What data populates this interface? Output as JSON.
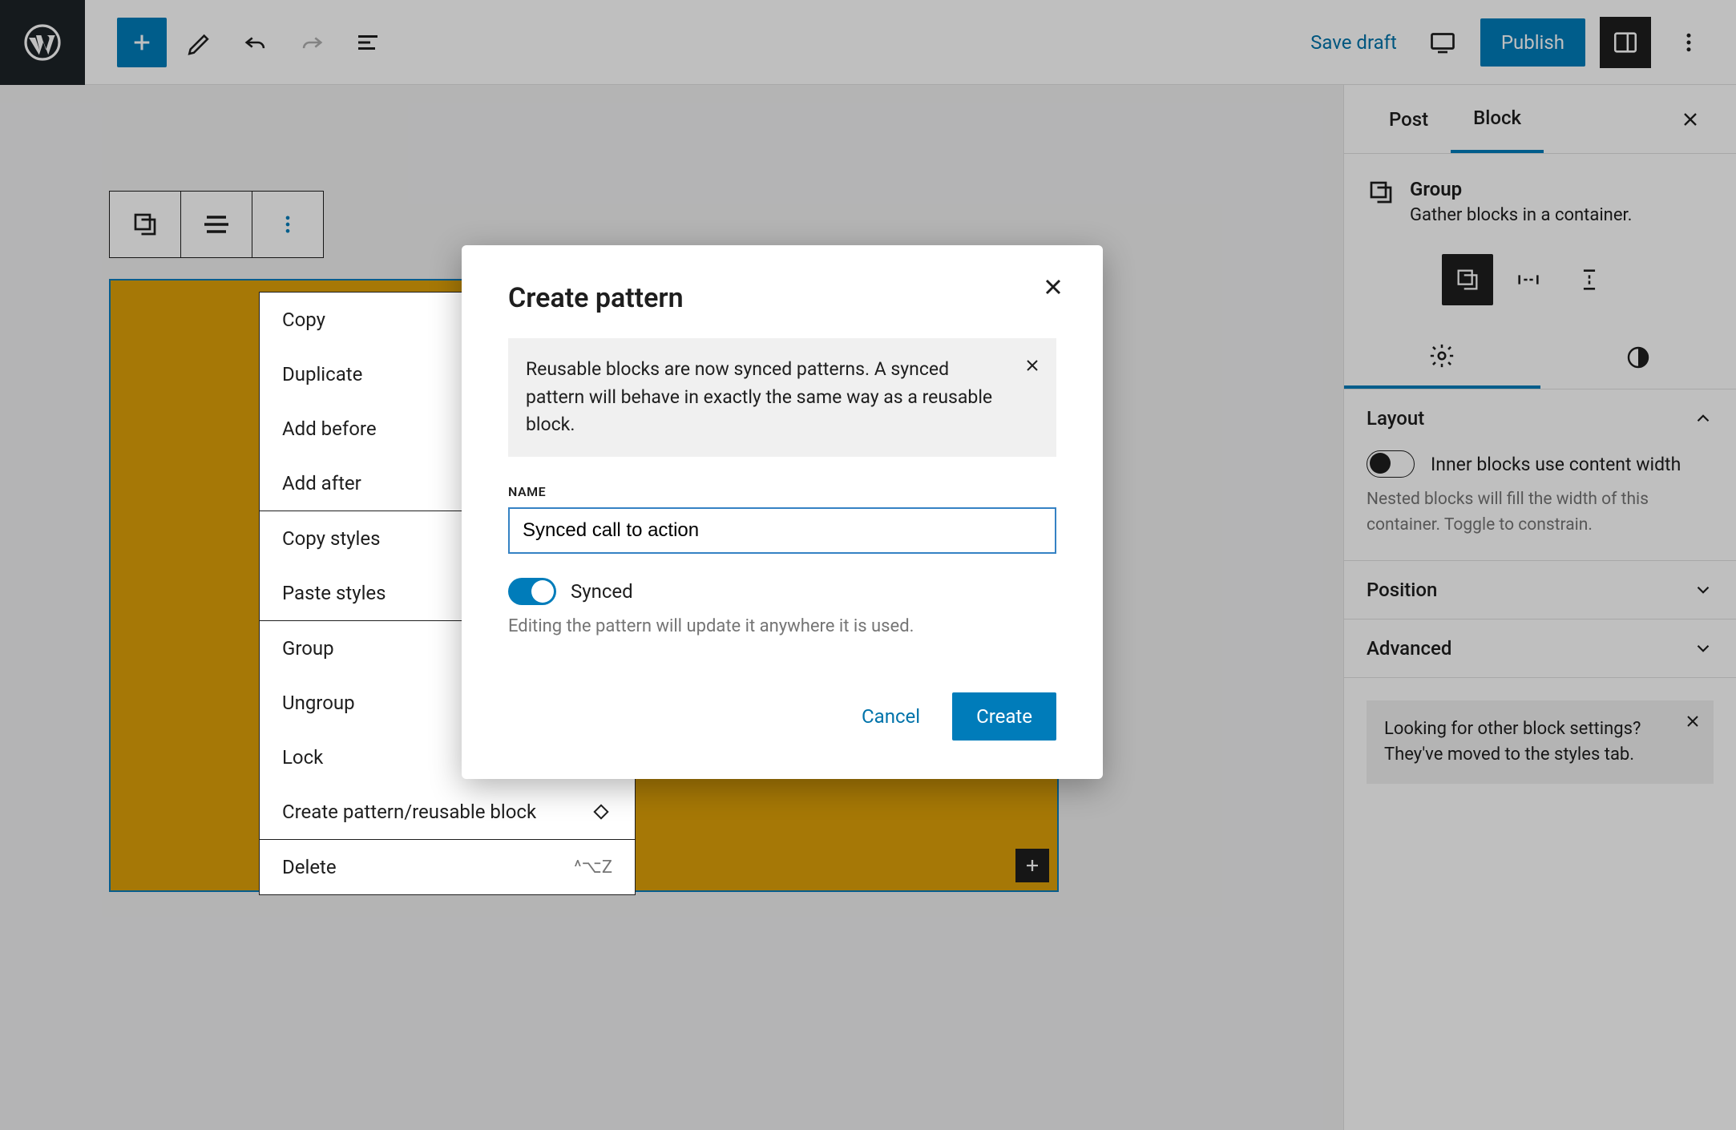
{
  "header": {
    "save_draft": "Save draft",
    "publish": "Publish"
  },
  "context_menu": {
    "items": [
      "Copy",
      "Duplicate",
      "Add before",
      "Add after",
      "Copy styles",
      "Paste styles",
      "Group",
      "Ungroup",
      "Lock",
      "Create pattern/reusable block",
      "Delete"
    ],
    "delete_shortcut": "^⌥Z"
  },
  "modal": {
    "title": "Create pattern",
    "notice": "Reusable blocks are now synced patterns. A synced pattern will behave in exactly the same way as a reusable block.",
    "name_label": "NAME",
    "name_value": "Synced call to action",
    "synced_label": "Synced",
    "synced_hint": "Editing the pattern will update it anywhere it is used.",
    "cancel": "Cancel",
    "create": "Create"
  },
  "sidebar": {
    "tabs": {
      "post": "Post",
      "block": "Block"
    },
    "block_title": "Group",
    "block_desc": "Gather blocks in a container.",
    "layout": {
      "heading": "Layout",
      "toggle_label": "Inner blocks use content width",
      "help": "Nested blocks will fill the width of this container. Toggle to constrain."
    },
    "position": {
      "heading": "Position"
    },
    "advanced": {
      "heading": "Advanced"
    },
    "tip": "Looking for other block settings? They've moved to the styles tab."
  }
}
